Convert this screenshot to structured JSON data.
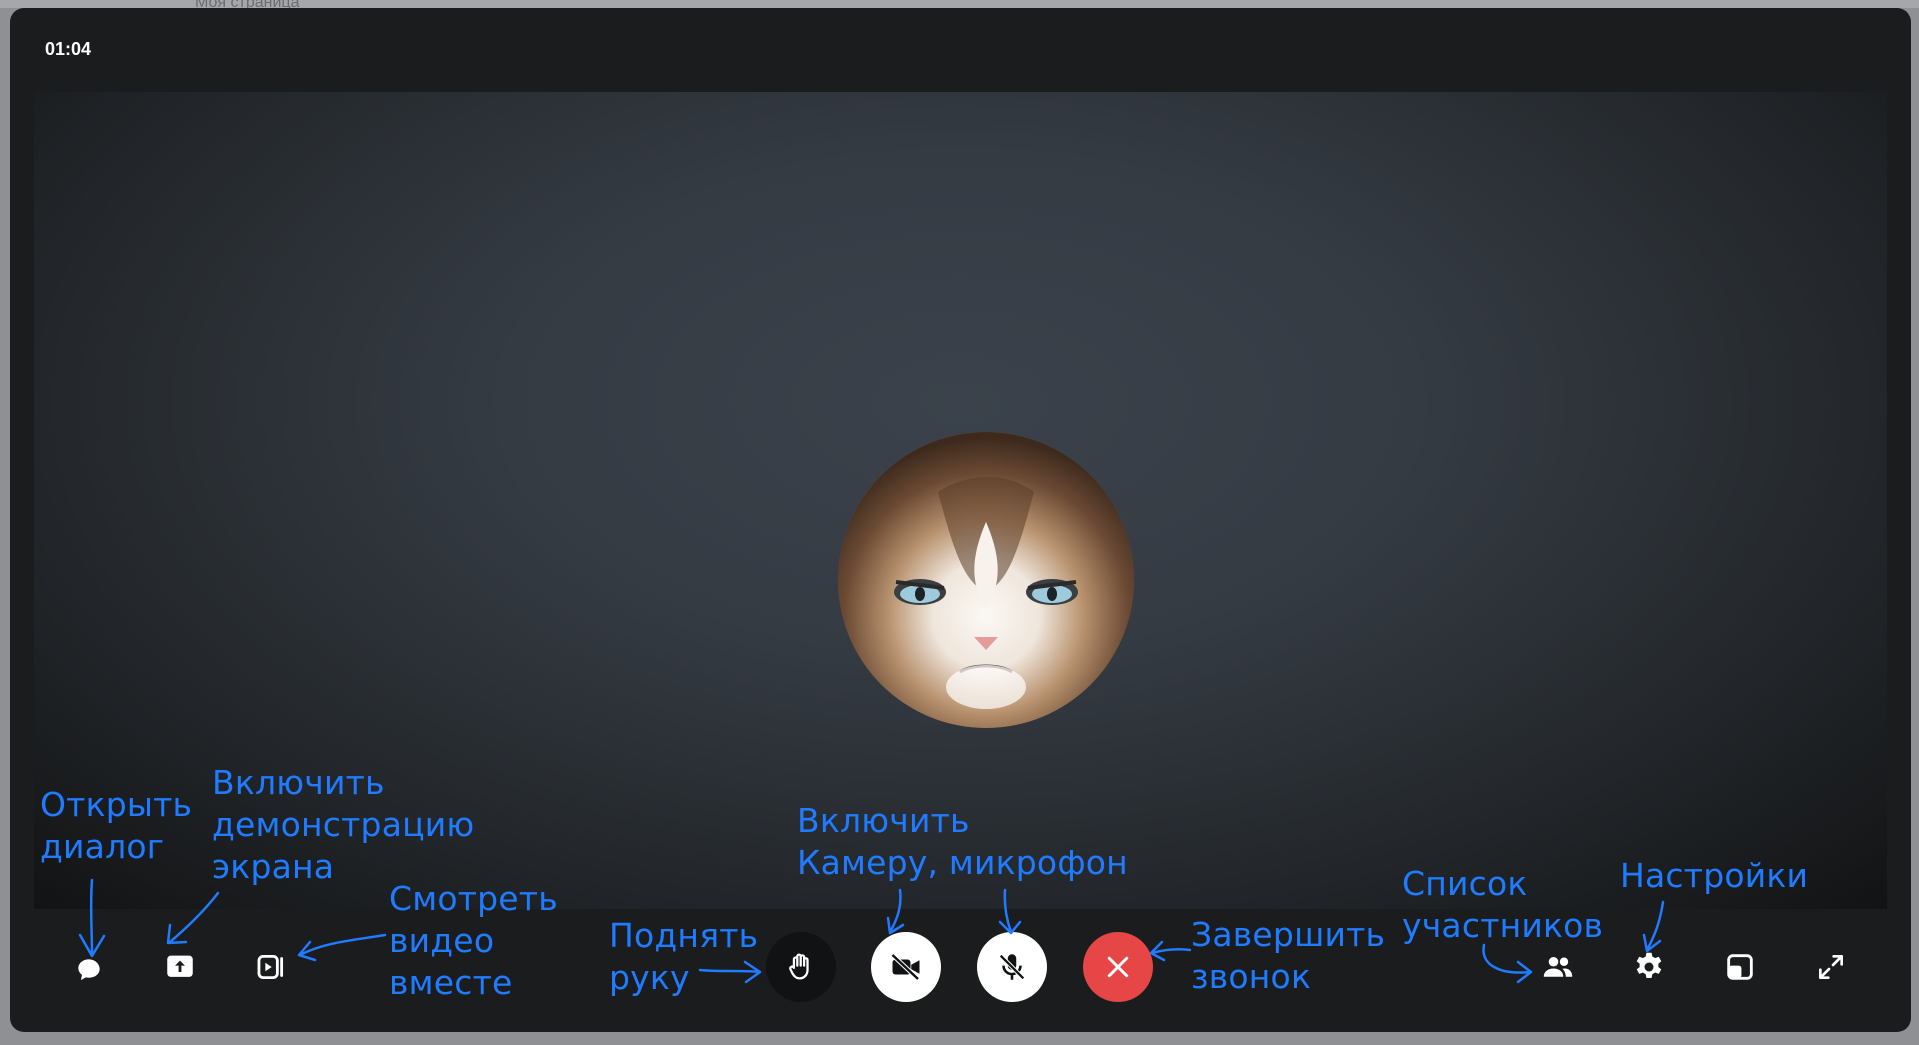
{
  "call": {
    "timer": "01:04"
  },
  "background_text": "Моя страница",
  "controls": {
    "chat": {
      "icon": "chat-bubble-icon"
    },
    "screen_share": {
      "icon": "screen-share-icon"
    },
    "watch_together": {
      "icon": "watch-together-icon"
    },
    "raise_hand": {
      "icon": "raise-hand-icon"
    },
    "camera": {
      "icon": "camera-off-icon"
    },
    "microphone": {
      "icon": "mic-off-icon"
    },
    "end_call": {
      "icon": "close-icon"
    },
    "participants": {
      "icon": "people-icon"
    },
    "settings": {
      "icon": "gear-icon"
    },
    "picture_in_picture": {
      "icon": "pip-icon"
    },
    "fullscreen": {
      "icon": "expand-icon"
    }
  },
  "annotations": {
    "open_dialog": "Открыть\nдиалог",
    "screen_share": "Включить\nдемонстрацию\nэкрана",
    "watch_together": "Смотреть\nвидео\nвместе",
    "raise_hand": "Поднять\nруку",
    "camera_mic": "Включить\nКамеру, микрофон",
    "end_call": "Завершить\nзвонок",
    "participants": "Список\nучастников",
    "settings": "Настройки"
  },
  "colors": {
    "annotation": "#1f7bff",
    "end_call": "#e64646",
    "window": "#1b1c1d"
  }
}
